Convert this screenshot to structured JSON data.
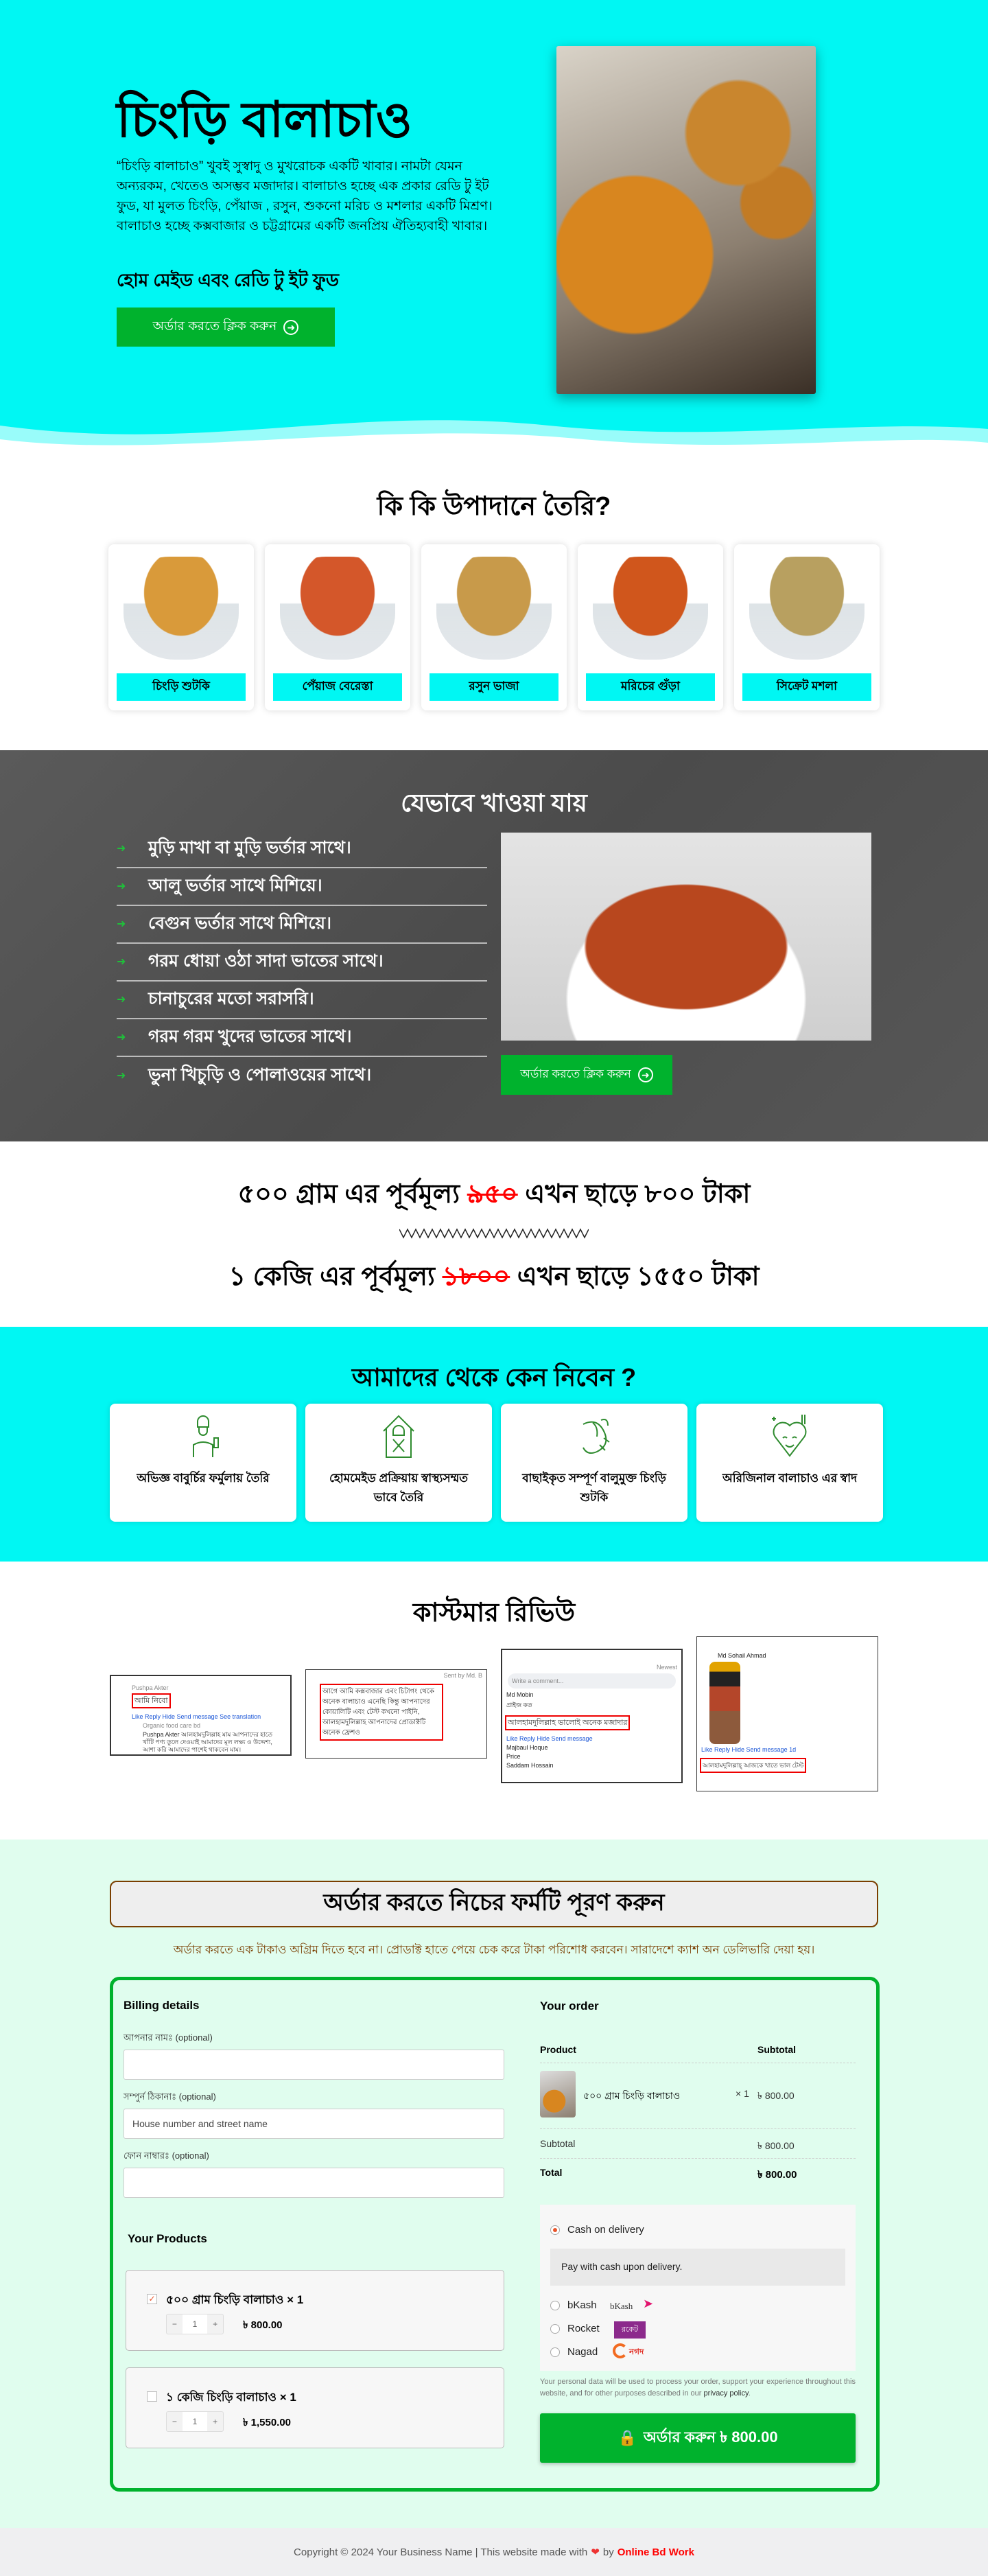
{
  "hero": {
    "title": "চিংড়ি বালাচাও",
    "description": "“চিংড়ি বালাচাও” খুবই সুস্বাদু ও মুখরোচক একটি খাবার। নামটা যেমন অন্যরকম, খেতেও অসম্ভব মজাদার। বালাচাও হচ্ছে এক প্রকার রেডি টু ইট ফুড, যা মুলত চিংড়ি, পেঁয়াজ , রসুন, শুকনো মরিচ ও মশলার একটি মিশ্রণ। বালাচাও হচ্ছে কক্সবাজার ও চট্টগ্রামের একটি জনপ্রিয় ঐতিহ্যবাহী খাবার।",
    "subtitle": "হোম মেইড এবং রেডি টু ইট ফুড",
    "cta_label": "অর্ডার করতে ক্লিক করুন"
  },
  "ingredients": {
    "title": "কি কি উপাদানে তৈরি?",
    "items": [
      {
        "label": "চিংড়ি শুটকি",
        "color": "#d99a3a"
      },
      {
        "label": "পেঁয়াজ বেরেস্তা",
        "color": "#d4572a"
      },
      {
        "label": "রসুন ভাজা",
        "color": "#c89a4a"
      },
      {
        "label": "মরিচের গুঁড়া",
        "color": "#d0561c"
      },
      {
        "label": "সিক্রেট মশলা",
        "color": "#b8a060"
      }
    ]
  },
  "serving": {
    "title": "যেভাবে খাওয়া যায়",
    "items": [
      "মুড়ি মাখা বা মুড়ি ভর্তার সাথে।",
      "আলু ভর্তার সাথে মিশিয়ে।",
      "বেগুন ভর্তার সাথে মিশিয়ে।",
      "গরম ধোয়া ওঠা সাদা ভাতের সাথে।",
      "চানাচুরের মতো সরাসরি।",
      "গরম গরম খুদের ভাতের সাথে।",
      "ভুনা খিচুড়ি ও পোলাওয়ের সাথে।"
    ],
    "cta_label": "অর্ডার করতে ক্লিক করুন"
  },
  "pricing": {
    "line1": {
      "pre": "৫০০ গ্রাম এর পূর্বমূল্য",
      "old": "৯৫০",
      "mid": "এখন ছাড়ে",
      "new": "৮০০ টাকা"
    },
    "line2": {
      "pre": "১ কেজি এর পূর্বমূল্য",
      "old": "১৮০০",
      "mid": "এখন ছাড়ে",
      "new": "১৫৫০ টাকা"
    }
  },
  "why_us": {
    "title": "আমাদের থেকে কেন নিবেন ?",
    "items": [
      {
        "icon": "chef-icon",
        "text": "অভিজ্ঞ বাবুর্চির ফর্মুলায় তৈরি"
      },
      {
        "icon": "home-cooking-icon",
        "text": "হোমমেইড প্রক্রিয়ায় স্বাস্থ্যসম্মত ভাবে তৈরি"
      },
      {
        "icon": "shrimp-icon",
        "text": "বাছাইকৃত সম্পূর্ণ বালুমুক্ত চিংড়ি শুটকি"
      },
      {
        "icon": "heart-taste-icon",
        "text": "অরিজিনাল বালাচাও এর স্বাদ"
      }
    ]
  },
  "reviews": {
    "title": "কাস্টমার রিভিউ",
    "items": [
      {
        "name": "Pushpa Akter",
        "comment": "আমি নিবো",
        "reply_name": "Organic food care bd",
        "reply": "Pushpa Akter আলহামদুলিল্লাহ মাম আপনাদের হাতে খাঁটি পণ্য তুলে দেওয়াই আমাদের মূল লক্ষ্য ও উদ্দেশ্য, আশা করি আমাদের পাশেই থাকবেন মাম।",
        "actions": "Like  Reply  Hide  Send message  See translation"
      },
      {
        "comment": "আগে আমি কক্সবাজার এবং চিটাগং থেকে অনেক বালাচাও এনেছি কিন্তু আপনাদের কোয়ালিটি এবং টেস্ট কখনো পাইনি, আলহামদুলিল্লাহ আপনাদের প্রোডাক্টটি অনেক ফ্রেশও",
        "meta": "Sent by Md. B"
      },
      {
        "placeholder": "Write a comment...",
        "sort": "Newest",
        "name1": "Md Mobin",
        "c1": "প্রাইজ কত",
        "comment": "আলহামদুলিল্লাহ ভালোই অনেক মজাদার",
        "name2": "Majbaul Hoque",
        "c2": "Price",
        "name3": "Saddam Hossain",
        "actions": "Like  Reply  Hide  Send message"
      },
      {
        "name": "Md Sohail Ahmad",
        "comment": "আলহামদুলিল্লাহ্ আজকে খাতে ভাল টেস্ট",
        "actions": "Like  Reply  Hide  Send message  1d"
      }
    ]
  },
  "order": {
    "heading": "অর্ডার করতে নিচের ফর্মটি পূরণ করুন",
    "notice": "অর্ডার করতে এক টাকাও অগ্রিম দিতে হবে না। প্রোডাক্ট হাতে পেয়ে চেক করে টাকা পরিশোধ করবেন। সারাদেশে ক্যাশ অন ডেলিভারি দেয়া হয়।",
    "billing": {
      "title": "Billing details",
      "fields": [
        {
          "label": "আপনার নামঃ",
          "optional": "(optional)",
          "value": "",
          "placeholder": ""
        },
        {
          "label": "সম্পুর্ন ঠিকানাঃ",
          "optional": "(optional)",
          "value": "",
          "placeholder": "House number and street name"
        },
        {
          "label": "ফোন নাম্বারঃ",
          "optional": "(optional)",
          "value": "",
          "placeholder": ""
        }
      ]
    },
    "products": {
      "title": "Your Products",
      "items": [
        {
          "name": "৫০০ গ্রাম চিংড়ি বালাচাও",
          "qty_label": "× 1",
          "qty": "1",
          "price": "৳ 800.00",
          "checked": true
        },
        {
          "name": "১ কেজি চিংড়ি বালাচাও",
          "qty_label": "× 1",
          "qty": "1",
          "price": "৳ 1,550.00",
          "checked": false
        }
      ]
    },
    "summary": {
      "title": "Your order",
      "col_product": "Product",
      "col_subtotal": "Subtotal",
      "item_name": "৫০০ গ্রাম চিংড়ি বালাচাও",
      "item_qty": "× 1",
      "item_price": "৳ 800.00",
      "subtotal_label": "Subtotal",
      "subtotal": "৳ 800.00",
      "total_label": "Total",
      "total": "৳ 800.00"
    },
    "payment": {
      "methods": [
        {
          "label": "Cash on delivery",
          "selected": true
        },
        {
          "label": "bKash",
          "logo": "bKash"
        },
        {
          "label": "Rocket",
          "logo": "রকেট"
        },
        {
          "label": "Nagad",
          "logo": "নগদ"
        }
      ],
      "cod_desc": "Pay with cash upon delivery."
    },
    "privacy_text": "Your personal data will be used to process your order, support your experience throughout this website, and for other purposes described in our",
    "privacy_link": "privacy policy",
    "submit_label": "অর্ডার করুন  ৳ 800.00"
  },
  "footer": {
    "text": "Copyright © 2024 Your Business Name | This website made with",
    "by": "by",
    "brand": "Online Bd Work"
  },
  "colors": {
    "cyan": "#00f7f3",
    "green": "#00b22d",
    "mint": "#e0fdee",
    "red": "#ff0000",
    "brown": "#7a3e00"
  }
}
